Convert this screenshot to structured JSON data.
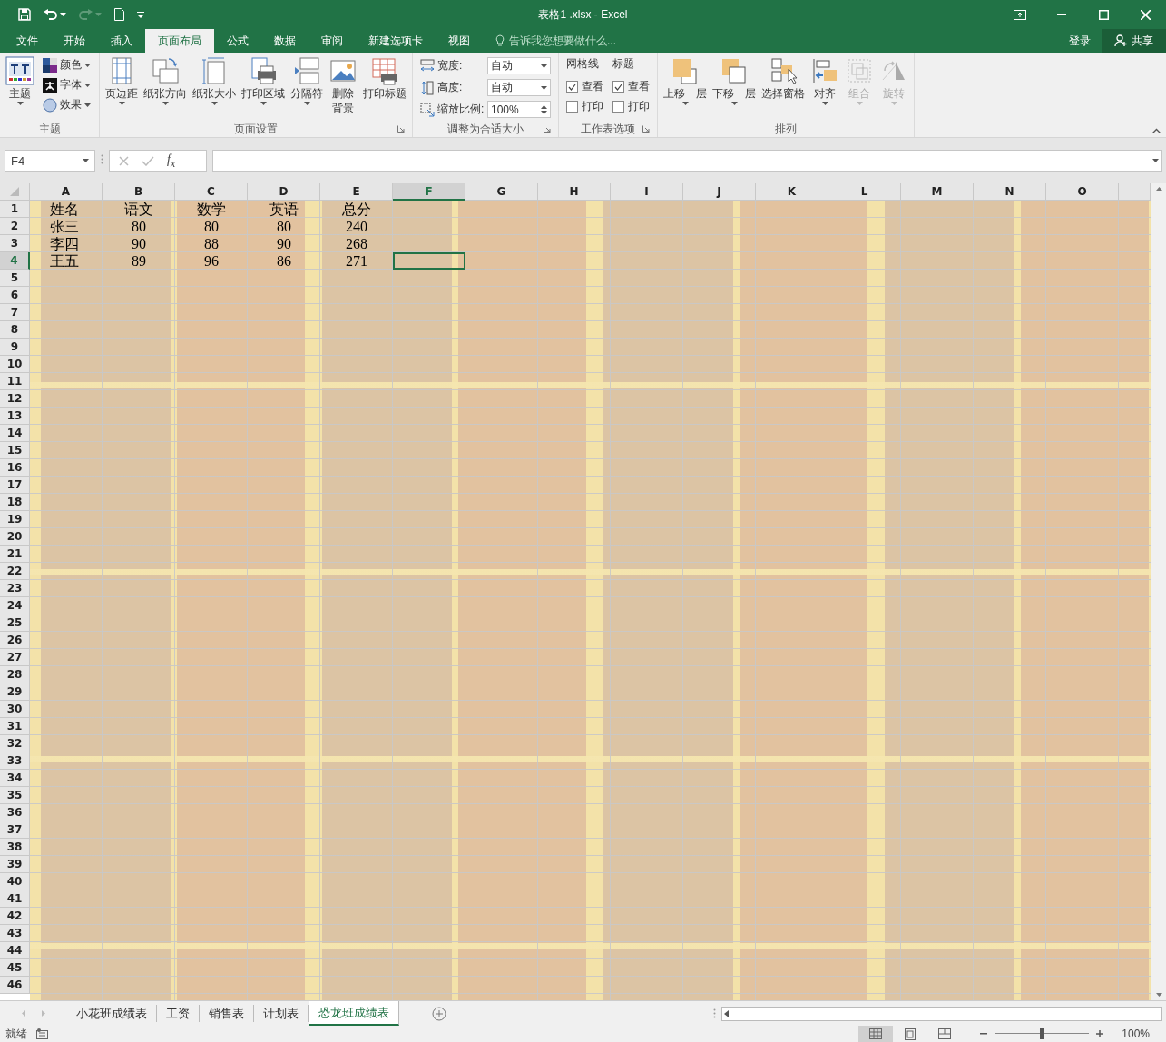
{
  "title_bar": {
    "title": "表格1 .xlsx - Excel"
  },
  "ribbon_tabs": [
    {
      "label": "文件",
      "selected": false
    },
    {
      "label": "开始",
      "selected": false
    },
    {
      "label": "插入",
      "selected": false
    },
    {
      "label": "页面布局",
      "selected": true
    },
    {
      "label": "公式",
      "selected": false
    },
    {
      "label": "数据",
      "selected": false
    },
    {
      "label": "审阅",
      "selected": false
    },
    {
      "label": "新建选项卡",
      "selected": false
    },
    {
      "label": "视图",
      "selected": false
    }
  ],
  "tell_me": {
    "placeholder": "告诉我您想要做什么..."
  },
  "account": {
    "sign_in": "登录",
    "share": "共享"
  },
  "ribbon_groups": [
    {
      "label": "主题",
      "launcher": false,
      "items": [
        {
          "kind": "large",
          "label": "主题",
          "dropdown": true,
          "disabled": false
        },
        {
          "kind": "small",
          "label": "颜色"
        },
        {
          "kind": "small",
          "label": "字体"
        },
        {
          "kind": "small",
          "label": "效果"
        }
      ]
    },
    {
      "label": "页面设置",
      "launcher": true,
      "items": [
        {
          "kind": "large",
          "label": "页边距",
          "dropdown": true,
          "disabled": false
        },
        {
          "kind": "large",
          "label": "纸张方向",
          "dropdown": true,
          "disabled": false
        },
        {
          "kind": "large",
          "label": "纸张大小",
          "dropdown": true,
          "disabled": false
        },
        {
          "kind": "large",
          "label": "打印区域",
          "dropdown": true,
          "disabled": false
        },
        {
          "kind": "large",
          "label": "分隔符",
          "dropdown": true,
          "disabled": false
        },
        {
          "kind": "large",
          "lines": [
            "删除",
            "背景"
          ],
          "dropdown": false,
          "disabled": false
        },
        {
          "kind": "large",
          "label": "打印标题",
          "dropdown": false,
          "disabled": false
        }
      ]
    },
    {
      "label": "调整为合适大小",
      "launcher": true,
      "items": [
        {
          "kind": "dropdown_field",
          "label": "宽度:",
          "value": "自动"
        },
        {
          "kind": "dropdown_field",
          "label": "高度:",
          "value": "自动"
        },
        {
          "kind": "spinner_field",
          "label": "缩放比例:",
          "value": "100%"
        }
      ]
    },
    {
      "label": "工作表选项",
      "launcher": true,
      "items": [
        {
          "kind": "options",
          "heading": "网格线",
          "checks": [
            {
              "label": "查看",
              "checked": true
            },
            {
              "label": "打印",
              "checked": false
            }
          ]
        },
        {
          "kind": "options",
          "heading": "标题",
          "checks": [
            {
              "label": "查看",
              "checked": true
            },
            {
              "label": "打印",
              "checked": false
            }
          ]
        }
      ]
    },
    {
      "label": "排列",
      "launcher": false,
      "items": [
        {
          "kind": "large",
          "label": "上移一层",
          "dropdown": true,
          "disabled": false
        },
        {
          "kind": "large",
          "label": "下移一层",
          "dropdown": true,
          "disabled": false
        },
        {
          "kind": "large",
          "label": "选择窗格",
          "dropdown": false,
          "disabled": false
        },
        {
          "kind": "large",
          "label": "对齐",
          "dropdown": true,
          "disabled": false
        },
        {
          "kind": "large",
          "label": "组合",
          "dropdown": true,
          "disabled": true
        },
        {
          "kind": "large",
          "label": "旋转",
          "dropdown": true,
          "disabled": true
        }
      ]
    }
  ],
  "formula_bar": {
    "name_box": "F4",
    "insert_function": "f$_{x}$"
  },
  "sheet": {
    "columns": [
      {
        "label": "A",
        "selected": false
      },
      {
        "label": "B",
        "selected": false
      },
      {
        "label": "C",
        "selected": false
      },
      {
        "label": "D",
        "selected": false
      },
      {
        "label": "E",
        "selected": false
      },
      {
        "label": "F",
        "selected": true
      },
      {
        "label": "G",
        "selected": false
      },
      {
        "label": "H",
        "selected": false
      },
      {
        "label": "I",
        "selected": false
      },
      {
        "label": "J",
        "selected": false
      },
      {
        "label": "K",
        "selected": false
      },
      {
        "label": "L",
        "selected": false
      },
      {
        "label": "M",
        "selected": false
      },
      {
        "label": "N",
        "selected": false
      },
      {
        "label": "O",
        "selected": false
      }
    ],
    "rows": [
      {
        "label": "1",
        "selected": false,
        "cells": [
          "姓名",
          "语文",
          "数学",
          "英语",
          "总分"
        ]
      },
      {
        "label": "2",
        "selected": false,
        "cells": [
          "张三",
          "80",
          "80",
          "80",
          "240"
        ]
      },
      {
        "label": "3",
        "selected": false,
        "cells": [
          "李四",
          "90",
          "88",
          "90",
          "268"
        ]
      },
      {
        "label": "4",
        "selected": true,
        "cells": [
          "王五",
          "89",
          "96",
          "86",
          "271"
        ]
      },
      {
        "label": "5",
        "selected": false
      },
      {
        "label": "6",
        "selected": false
      },
      {
        "label": "7",
        "selected": false
      },
      {
        "label": "8",
        "selected": false
      },
      {
        "label": "9",
        "selected": false
      },
      {
        "label": "10",
        "selected": false
      },
      {
        "label": "11",
        "selected": false
      },
      {
        "label": "12",
        "selected": false
      },
      {
        "label": "13",
        "selected": false
      },
      {
        "label": "14",
        "selected": false
      },
      {
        "label": "15",
        "selected": false
      },
      {
        "label": "16",
        "selected": false
      },
      {
        "label": "17",
        "selected": false
      },
      {
        "label": "18",
        "selected": false
      },
      {
        "label": "19",
        "selected": false
      },
      {
        "label": "20",
        "selected": false
      },
      {
        "label": "21",
        "selected": false
      },
      {
        "label": "22",
        "selected": false
      },
      {
        "label": "23",
        "selected": false
      },
      {
        "label": "24",
        "selected": false
      },
      {
        "label": "25",
        "selected": false
      },
      {
        "label": "26",
        "selected": false
      },
      {
        "label": "27",
        "selected": false
      },
      {
        "label": "28",
        "selected": false
      },
      {
        "label": "29",
        "selected": false
      },
      {
        "label": "30",
        "selected": false
      },
      {
        "label": "31",
        "selected": false
      },
      {
        "label": "32",
        "selected": false
      },
      {
        "label": "33",
        "selected": false
      },
      {
        "label": "34",
        "selected": false
      },
      {
        "label": "35",
        "selected": false
      },
      {
        "label": "36",
        "selected": false
      },
      {
        "label": "37",
        "selected": false
      },
      {
        "label": "38",
        "selected": false
      },
      {
        "label": "39",
        "selected": false
      },
      {
        "label": "40",
        "selected": false
      },
      {
        "label": "41",
        "selected": false
      },
      {
        "label": "42",
        "selected": false
      },
      {
        "label": "43",
        "selected": false
      },
      {
        "label": "44",
        "selected": false
      },
      {
        "label": "45",
        "selected": false
      },
      {
        "label": "46",
        "selected": false
      }
    ]
  },
  "sheet_tabs": [
    {
      "label": "小花班成绩表",
      "selected": false
    },
    {
      "label": "工资",
      "selected": false
    },
    {
      "label": "销售表",
      "selected": false
    },
    {
      "label": "计划表",
      "selected": false
    },
    {
      "label": "恐龙班成绩表",
      "selected": true
    }
  ],
  "status_bar": {
    "text": "就绪",
    "views": [
      {
        "selected": true
      },
      {
        "selected": false
      },
      {
        "selected": false
      }
    ],
    "zoom_slider": {
      "level": 0.5
    },
    "zoom": "100%"
  }
}
